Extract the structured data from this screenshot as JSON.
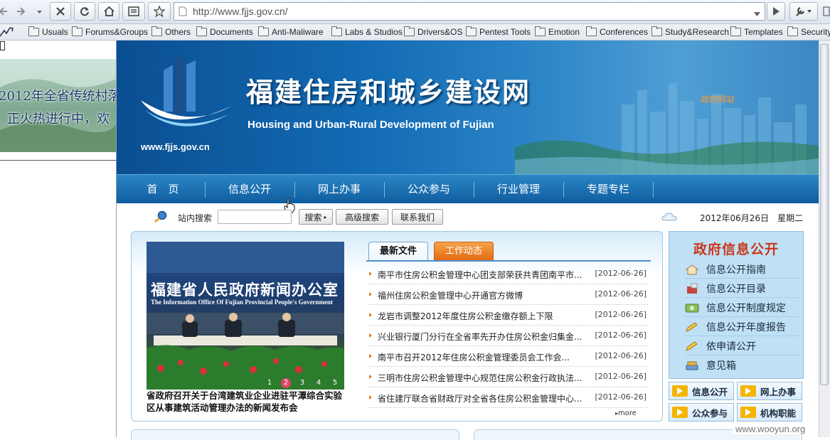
{
  "browser": {
    "url": "http://www.fjjs.gov.cn/",
    "bookmarks": [
      "Usuals",
      "Forums&Groups",
      "Others",
      "Documents",
      "Anti-Maliware",
      "Labs & Studios",
      "Drivers&OS",
      "Pentest Tools",
      "Emotion",
      "Conferences",
      "Study&Research",
      "Templates",
      "Security"
    ]
  },
  "left_ad": {
    "line1": "2012年全省传统村落",
    "line2": "正火热进行中，欢"
  },
  "banner": {
    "title": "福建住房和城乡建设网",
    "subtitle": "Housing and Urban-Rural Development of Fujian",
    "url": "www.fjjs.gov.cn",
    "gov_link": "政府网站"
  },
  "nav": {
    "items": [
      "首　页",
      "信息公开",
      "网上办事",
      "公众参与",
      "行业管理",
      "专题专栏"
    ]
  },
  "search": {
    "label": "站内搜索",
    "search_button": "搜索",
    "advanced_button": "高级搜索",
    "contact_button": "联系我们",
    "date": "2012年06月26日　星期二"
  },
  "photo": {
    "header": "福建省人民政府新闻办公室",
    "subheader": "The Information Office Of Fujian Provincial People's Government",
    "pages": [
      "1",
      "2",
      "3",
      "4",
      "5"
    ],
    "current_page": 2,
    "caption": "省政府召开关于台湾建筑业企业进驻平潭综合实验区从事建筑活动管理办法的新闻发布会"
  },
  "tabs": {
    "latest": "最新文件",
    "work": "工作动态"
  },
  "news": [
    {
      "title": "南平市住房公积金管理中心团支部荣获共青团南平市...",
      "date": "[2012-06-26]"
    },
    {
      "title": "福州住房公积金管理中心开通官方微博",
      "date": "[2012-06-26]"
    },
    {
      "title": "龙岩市调整2012年度住房公积金缴存额上下限",
      "date": "[2012-06-26]"
    },
    {
      "title": "兴业银行厦门分行在全省率先开办住房公积金归集金...",
      "date": "[2012-06-26]"
    },
    {
      "title": "南平市召开2012年住房公积金管理委员会工作会...",
      "date": "[2012-06-26]"
    },
    {
      "title": "三明市住房公积金管理中心规范住房公积金行政执法...",
      "date": "[2012-06-26]"
    },
    {
      "title": "省住建厅联合省财政厅对全省各住房公积金管理中心...",
      "date": "[2012-06-26]"
    }
  ],
  "more": "more",
  "gov_info": {
    "title": "政府信息公开",
    "items": [
      "信息公开指南",
      "信息公开目录",
      "信息公开制度规定",
      "信息公开年度报告",
      "依申请公开",
      "意见箱"
    ]
  },
  "quick": [
    "信息公开",
    "网上办事",
    "公众参与",
    "机构职能"
  ],
  "watermark": "www.wooyun.org",
  "colors": {
    "nav_blue": "#1a6fb0",
    "tab_orange": "#e8751f",
    "title_red": "#c9391a",
    "accent_yellow": "#f6b400"
  }
}
